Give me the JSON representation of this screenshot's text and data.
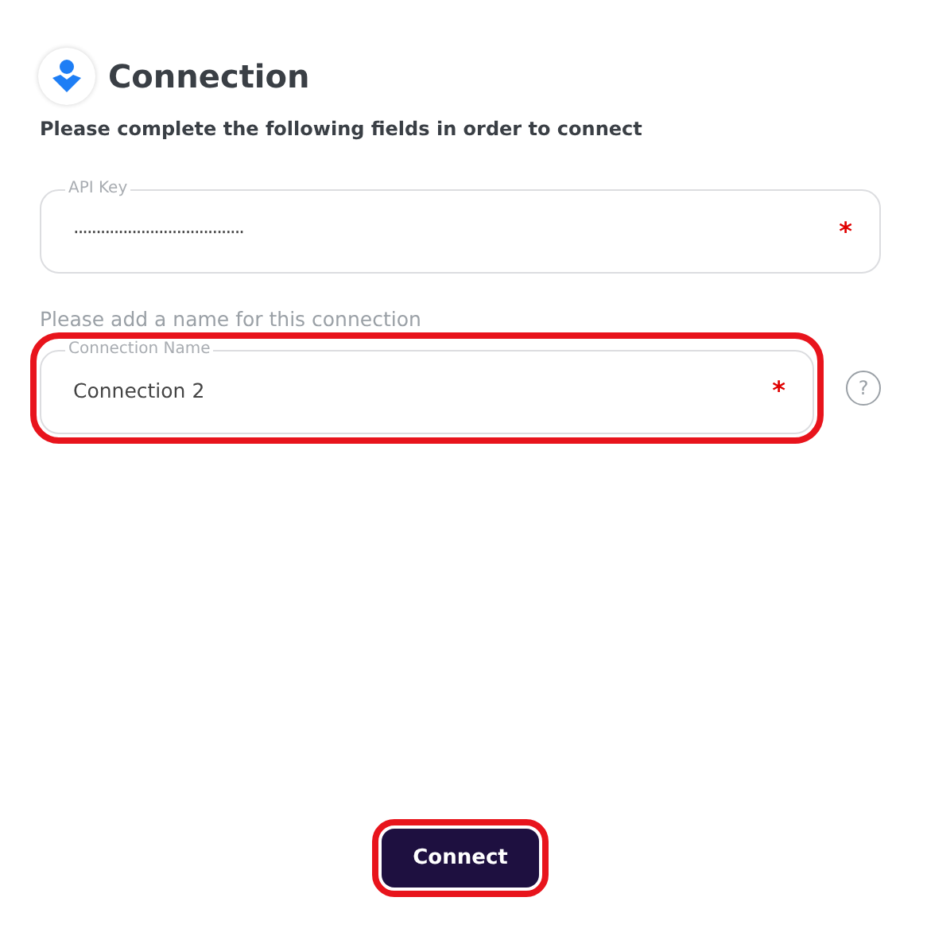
{
  "header": {
    "title": "Connection"
  },
  "instructions": "Please complete the following fields in order to connect",
  "fields": [
    {
      "legend": "API Key",
      "value": "······································",
      "required_mark": "*",
      "kind": "masked",
      "highlighted": false,
      "help": false
    },
    {
      "legend": "Connection Name",
      "value": "Connection 2",
      "required_mark": "*",
      "kind": "text",
      "highlighted": true,
      "help": true,
      "caption": "Please add a name for this connection"
    }
  ],
  "help_icon": "?",
  "button": {
    "label": "Connect",
    "highlighted": true
  }
}
